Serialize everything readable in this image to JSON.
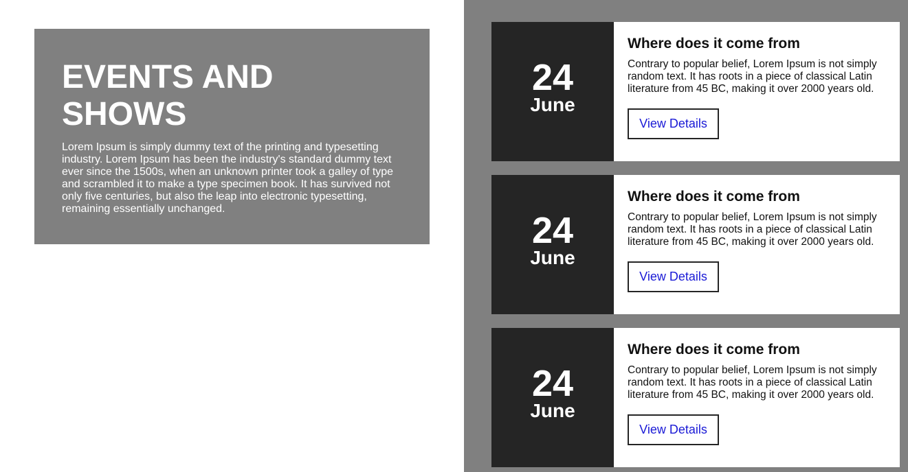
{
  "hero": {
    "title": "EVENTS AND SHOWS",
    "text": "Lorem Ipsum is simply dummy text of the printing and typesetting industry. Lorem Ipsum has been the industry's standard dummy text ever since the 1500s, when an unknown printer took a galley of type and scrambled it to make a type specimen book. It has survived not only five centuries, but also the leap into electronic typesetting, remaining essentially unchanged."
  },
  "events": [
    {
      "day": "24",
      "month": "June",
      "title": "Where does it come from",
      "text": "Contrary to popular belief, Lorem Ipsum is not simply random text. It has roots in a piece of classical Latin literature from 45 BC, making it over 2000 years old.",
      "button_label": "View Details"
    },
    {
      "day": "24",
      "month": "June",
      "title": "Where does it come from",
      "text": "Contrary to popular belief, Lorem Ipsum is not simply random text. It has roots in a piece of classical Latin literature from 45 BC, making it over 2000 years old.",
      "button_label": "View Details"
    },
    {
      "day": "24",
      "month": "June",
      "title": "Where does it come from",
      "text": "Contrary to popular belief, Lorem Ipsum is not simply random text. It has roots in a piece of classical Latin literature from 45 BC, making it over 2000 years old.",
      "button_label": "View Details"
    }
  ],
  "colors": {
    "panel_gray": "#808080",
    "date_block": "#252525",
    "link_blue": "#1a1ad6"
  }
}
